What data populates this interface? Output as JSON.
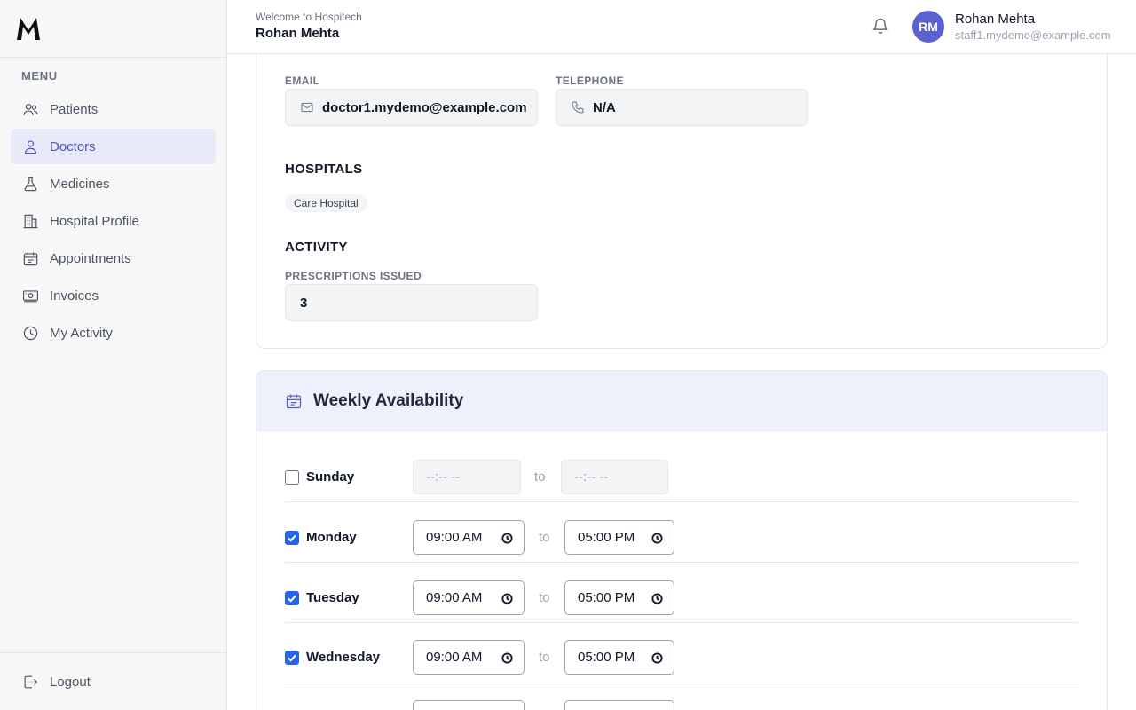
{
  "header": {
    "welcome": "Welcome to Hospitech",
    "name": "Rohan Mehta",
    "avatar_initials": "RM",
    "user_name": "Rohan Mehta",
    "user_email": "staff1.mydemo@example.com"
  },
  "sidebar": {
    "logo": "M",
    "menu_label": "MENU",
    "items": [
      {
        "label": "Patients",
        "icon": "users-icon"
      },
      {
        "label": "Doctors",
        "icon": "user-icon",
        "active": true
      },
      {
        "label": "Medicines",
        "icon": "flask-icon"
      },
      {
        "label": "Hospital Profile",
        "icon": "building-icon"
      },
      {
        "label": "Appointments",
        "icon": "calendar-icon"
      },
      {
        "label": "Invoices",
        "icon": "banknote-icon"
      },
      {
        "label": "My Activity",
        "icon": "clock-icon"
      }
    ],
    "logout": "Logout"
  },
  "profile": {
    "email_label": "EMAIL",
    "email_value": "doctor1.mydemo@example.com",
    "telephone_label": "TELEPHONE",
    "telephone_value": "N/A",
    "hospitals_title": "HOSPITALS",
    "hospitals": [
      "Care Hospital"
    ],
    "activity_title": "ACTIVITY",
    "prescriptions_label": "PRESCRIPTIONS ISSUED",
    "prescriptions_value": "3"
  },
  "availability": {
    "title": "Weekly Availability",
    "to_label": "to",
    "days": [
      {
        "day": "Sunday",
        "enabled": false,
        "start": "--:-- --",
        "end": "--:-- --"
      },
      {
        "day": "Monday",
        "enabled": true,
        "start": "09:00 AM",
        "end": "05:00 PM"
      },
      {
        "day": "Tuesday",
        "enabled": true,
        "start": "09:00 AM",
        "end": "05:00 PM"
      },
      {
        "day": "Wednesday",
        "enabled": true,
        "start": "09:00 AM",
        "end": "05:00 PM"
      }
    ]
  },
  "colors": {
    "accent": "#5b61d0",
    "active_nav_bg": "#e9eaf8",
    "checkbox": "#2563eb"
  }
}
